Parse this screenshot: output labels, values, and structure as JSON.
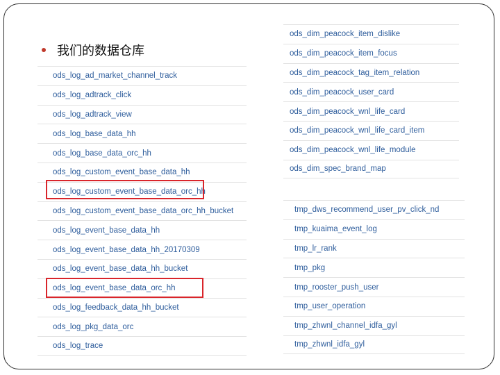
{
  "slide": {
    "heading": "我们的数据仓库",
    "accent_color": "#c0392b",
    "link_color": "#2e5d9c",
    "highlight_color": "#d9252b"
  },
  "left_tables": [
    "ods_log_ad_market_channel_track",
    "ods_log_adtrack_click",
    "ods_log_adtrack_view",
    "ods_log_base_data_hh",
    "ods_log_base_data_orc_hh",
    "ods_log_custom_event_base_data_hh",
    "ods_log_custom_event_base_data_orc_hh",
    "ods_log_custom_event_base_data_orc_hh_bucket",
    "ods_log_event_base_data_hh",
    "ods_log_event_base_data_hh_20170309",
    "ods_log_event_base_data_hh_bucket",
    "ods_log_event_base_data_orc_hh",
    "ods_log_feedback_data_hh_bucket",
    "ods_log_pkg_data_orc",
    "ods_log_trace"
  ],
  "highlighted_tables": [
    "ods_log_custom_event_base_data_orc_hh",
    "ods_log_event_base_data_orc_hh"
  ],
  "right_top_tables": [
    "ods_dim_peacock_item_dislike",
    "ods_dim_peacock_item_focus",
    "ods_dim_peacock_tag_item_relation",
    "ods_dim_peacock_user_card",
    "ods_dim_peacock_wnl_life_card",
    "ods_dim_peacock_wnl_life_card_item",
    "ods_dim_peacock_wnl_life_module",
    "ods_dim_spec_brand_map"
  ],
  "right_bottom_tables": [
    "tmp_dws_recommend_user_pv_click_nd",
    "tmp_kuaima_event_log",
    "tmp_lr_rank",
    "tmp_pkg",
    "tmp_rooster_push_user",
    "tmp_user_operation",
    "tmp_zhwnl_channel_idfa_gyl",
    "tmp_zhwnl_idfa_gyl"
  ]
}
